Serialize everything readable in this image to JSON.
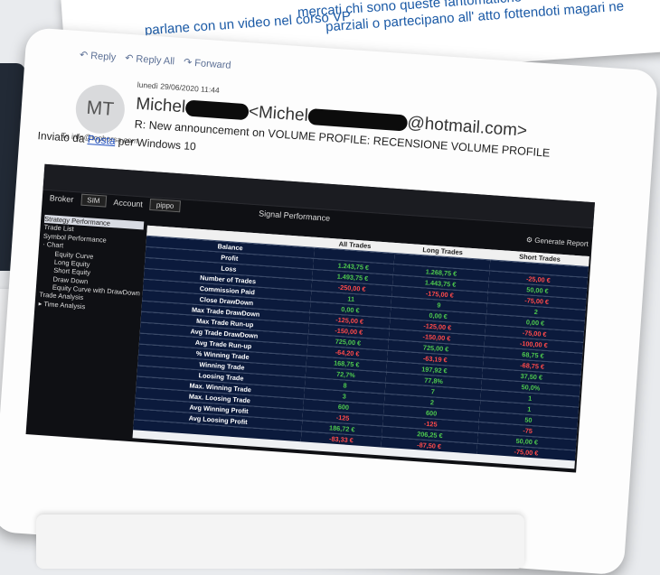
{
  "background_text": {
    "line1": "parziali o partecipano all' atto fottendoti magari ne",
    "line2": "parlane con un video nel corso VP",
    "line3": "mercati chi sono queste fantomatiche"
  },
  "email": {
    "actions": {
      "reply": "Reply",
      "reply_all": "Reply All",
      "forward": "Forward"
    },
    "avatar_initials": "MT",
    "date": "lunedì 29/06/2020 11:44",
    "sender_prefix": "Michel",
    "sender_mid": "<Michel",
    "sender_suffix": "@hotmail.com>",
    "subject": "R: New announcement on VOLUME PROFILE: RECENSIONE VOLUME PROFILE",
    "to_label": "To",
    "to_value": "info@topborsa.com",
    "sent_prefix": "Inviato da ",
    "sent_link": "Posta",
    "sent_suffix": " per Windows 10"
  },
  "app": {
    "broker_label": "Broker",
    "broker_value": "SIM",
    "account_label": "Account",
    "account_value": "pippo",
    "title": "Signal Performance",
    "generate": "Generate Report",
    "tree": [
      "Strategy Performance",
      "Trade List",
      "Symbol Performance",
      "Chart",
      "Equity Curve",
      "Long Equity",
      "Short Equity",
      "Draw Down",
      "Equity Curve with DrawDown",
      "Trade Analysis",
      "Time Analysis"
    ],
    "columns": [
      "",
      "All Trades",
      "Long Trades",
      "Short Trades"
    ],
    "rows": [
      [
        "Balance",
        "",
        "",
        ""
      ],
      [
        "Profit",
        "1.243,75 €",
        "1.268,75 €",
        "-25,00 €"
      ],
      [
        "Loss",
        "1.493,75 €",
        "1.443,75 €",
        "50,00 €"
      ],
      [
        "Number of Trades",
        "-250,00 €",
        "-175,00 €",
        "-75,00 €"
      ],
      [
        "Commission Paid",
        "11",
        "9",
        "2"
      ],
      [
        "Close DrawDown",
        "0,00 €",
        "0,00 €",
        "0,00 €"
      ],
      [
        "Max Trade DrawDown",
        "-125,00 €",
        "-125,00 €",
        "-75,00 €"
      ],
      [
        "Max Trade Run-up",
        "-150,00 €",
        "-150,00 €",
        "-100,00 €"
      ],
      [
        "Avg Trade DrawDown",
        "725,00 €",
        "725,00 €",
        "68,75 €"
      ],
      [
        "Avg Trade Run-up",
        "-64,20 €",
        "-63,19 €",
        "-68,75 €"
      ],
      [
        "% Winning Trade",
        "168,75 €",
        "197,92 €",
        "37,50 €"
      ],
      [
        "Winning Trade",
        "72,7%",
        "77,8%",
        "50,0%"
      ],
      [
        "Loosing Trade",
        "8",
        "7",
        "1"
      ],
      [
        "Max. Winning Trade",
        "3",
        "2",
        "1"
      ],
      [
        "Max. Loosing Trade",
        "600",
        "600",
        "50"
      ],
      [
        "Avg Winning Profit",
        "-125",
        "-125",
        "-75"
      ],
      [
        "Avg Loosing Profit",
        "186,72 €",
        "206,25 €",
        "50,00 €"
      ],
      [
        "",
        "-83,33 €",
        "-87,50 €",
        "-75,00 €"
      ]
    ]
  }
}
